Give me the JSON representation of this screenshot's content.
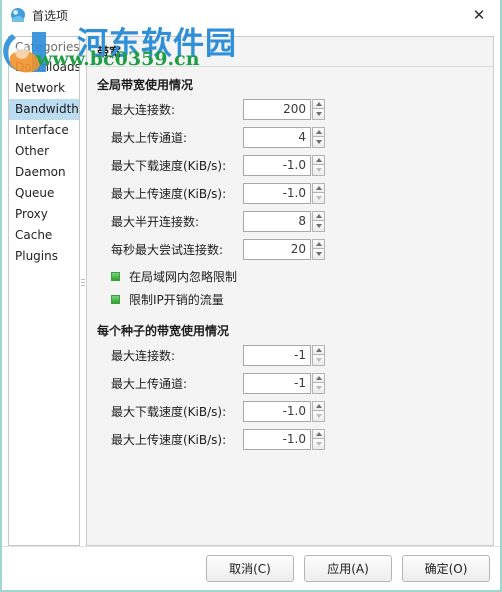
{
  "window": {
    "title": "首选项",
    "app_icon": "preferences-icon",
    "close_label": "✕"
  },
  "sidebar": {
    "header": "Categories",
    "selected": "Bandwidth",
    "items": [
      {
        "label": "Downloads"
      },
      {
        "label": "Network"
      },
      {
        "label": "Bandwidth"
      },
      {
        "label": "Interface"
      },
      {
        "label": "Other"
      },
      {
        "label": "Daemon"
      },
      {
        "label": "Queue"
      },
      {
        "label": "Proxy"
      },
      {
        "label": "Cache"
      },
      {
        "label": "Plugins"
      }
    ]
  },
  "panel": {
    "header": "带宽",
    "global_group_title": "全局带宽使用情况",
    "global_fields": [
      {
        "label": "最大连接数:",
        "value": "200"
      },
      {
        "label": "最大上传通道:",
        "value": "4"
      },
      {
        "label": "最大下载速度(KiB/s):",
        "value": "-1.0"
      },
      {
        "label": "最大上传速度(KiB/s):",
        "value": "-1.0"
      },
      {
        "label": "最大半开连接数:",
        "value": "8"
      },
      {
        "label": "每秒最大尝试连接数:",
        "value": "20"
      }
    ],
    "checkboxes": [
      {
        "label": "在局域网内忽略限制",
        "checked": true
      },
      {
        "label": "限制IP开销的流量",
        "checked": true
      }
    ],
    "per_torrent_group_title": "每个种子的带宽使用情况",
    "per_torrent_fields": [
      {
        "label": "最大连接数:",
        "value": "-1"
      },
      {
        "label": "最大上传通道:",
        "value": "-1"
      },
      {
        "label": "最大下载速度(KiB/s):",
        "value": "-1.0"
      },
      {
        "label": "最大上传速度(KiB/s):",
        "value": "-1.0"
      }
    ]
  },
  "footer": {
    "cancel_label": "取消(C)",
    "apply_label": "应用(A)",
    "ok_label": "确定(O)"
  },
  "watermark": {
    "site_name": "河东软件园",
    "url": "www.bc0359.cn"
  },
  "colors": {
    "window_border": "#9fd6d2",
    "selection": "#bcdcf2",
    "checkbox_green": "#2aa82a",
    "watermark_blue": "#2f8fd8",
    "watermark_green": "#1f9e46",
    "panel_bg": "#f4f4f4"
  }
}
